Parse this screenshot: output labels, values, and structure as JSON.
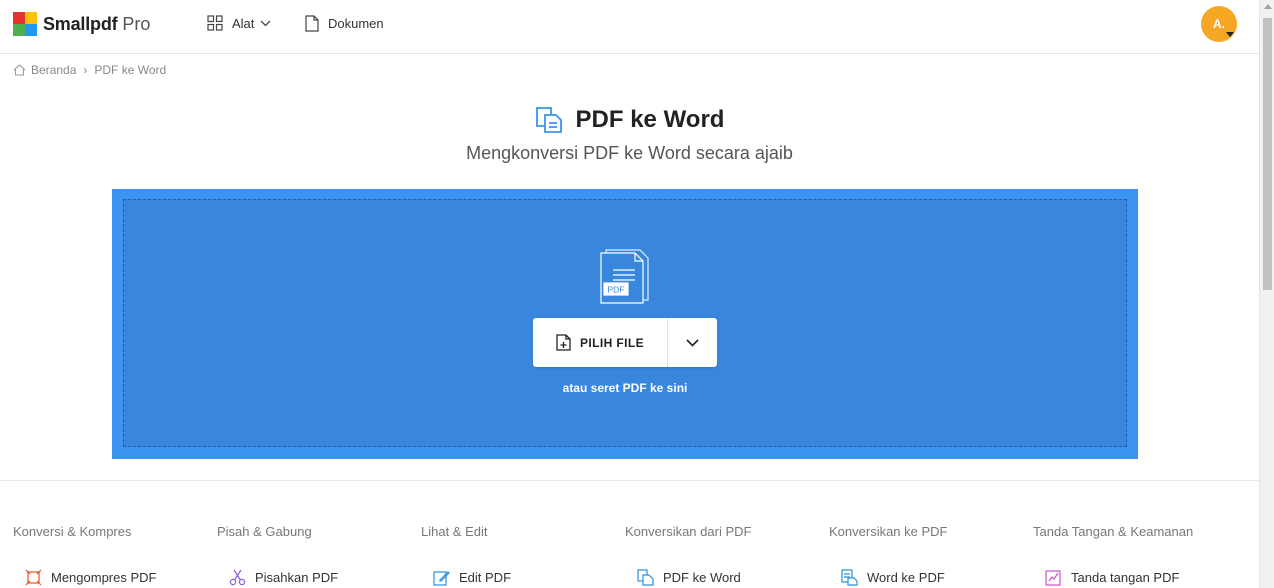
{
  "header": {
    "logo_text": "Smallpdf",
    "logo_pro": "Pro",
    "nav": [
      {
        "label": "Alat",
        "icon": "grid-icon"
      },
      {
        "label": "Dokumen",
        "icon": "document-icon"
      }
    ],
    "avatar_initials": "A."
  },
  "breadcrumb": {
    "home": "Beranda",
    "separator": "›",
    "current": "PDF ke Word"
  },
  "main": {
    "title": "PDF ke Word",
    "subtitle": "Mengkonversi PDF ke Word secara ajaib",
    "choose_label": "PILIH FILE",
    "drop_hint": "atau seret PDF ke sini",
    "pdf_icon_label": "PDF"
  },
  "tools": {
    "columns": [
      {
        "heading": "Konversi & Kompres",
        "item": "Mengompres PDF",
        "icon": "compress-icon"
      },
      {
        "heading": "Pisah & Gabung",
        "item": "Pisahkan PDF",
        "icon": "scissors-icon"
      },
      {
        "heading": "Lihat & Edit",
        "item": "Edit PDF",
        "icon": "edit-icon"
      },
      {
        "heading": "Konversikan dari PDF",
        "item": "PDF ke Word",
        "icon": "pdf-to-word-icon"
      },
      {
        "heading": "Konversikan ke PDF",
        "item": "Word ke PDF",
        "icon": "word-to-pdf-icon"
      },
      {
        "heading": "Tanda Tangan & Keamanan",
        "item": "Tanda tangan PDF",
        "icon": "sign-icon"
      }
    ]
  },
  "colors": {
    "accent_blue": "#3b95f0",
    "dropzone_inner": "#3887dd",
    "avatar": "#f5a623",
    "logo_red": "#e5322d",
    "logo_yellow": "#ffc107",
    "logo_green": "#4caf50",
    "logo_blue": "#2196f3"
  }
}
